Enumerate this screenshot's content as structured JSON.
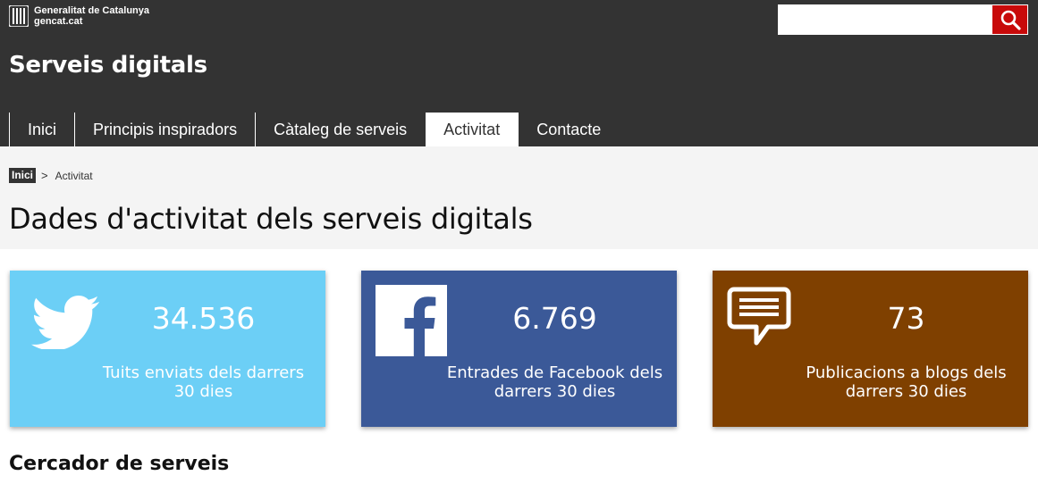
{
  "header": {
    "logo": {
      "line1": "Generalitat de Catalunya",
      "line2": "gencat.cat",
      "icon": "generalitat-flag-icon"
    },
    "search": {
      "value": "",
      "placeholder": "",
      "button_icon": "search-icon",
      "button_color": "#c80a0a"
    },
    "site_title": "Serveis digitals",
    "nav": [
      {
        "label": "Inici",
        "active": false
      },
      {
        "label": "Principis inspiradors",
        "active": false
      },
      {
        "label": "Càtaleg de serveis",
        "active": false
      },
      {
        "label": "Activitat",
        "active": true
      },
      {
        "label": "Contacte",
        "active": false
      }
    ]
  },
  "breadcrumb": {
    "home": "Inici",
    "separator": ">",
    "current": "Activitat"
  },
  "page_title": "Dades d'activitat dels serveis digitals",
  "cards": [
    {
      "value": "34.536",
      "label": "Tuits enviats dels darrers 30 dies",
      "icon": "twitter-icon",
      "color": "#6ccff6"
    },
    {
      "value": "6.769",
      "label": "Entrades de Facebook dels darrers 30 dies",
      "icon": "facebook-icon",
      "color": "#3b5998"
    },
    {
      "value": "73",
      "label": "Publicacions a blogs dels darrers 30 dies",
      "icon": "blog-comment-icon",
      "color": "#7f4000"
    }
  ],
  "section_title": "Cercador de serveis"
}
